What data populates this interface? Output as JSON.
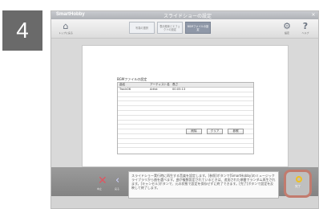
{
  "step_number": "4",
  "window": {
    "app_name": "SmartHobby",
    "title": "スライドショーの設定",
    "close_glyph": "×"
  },
  "toolbar": {
    "home_label": "トップに戻る",
    "settings_label": "設定",
    "help_label": "ヘルプ",
    "tabs": [
      {
        "label": "写真の選択"
      },
      {
        "label": "表示順序とエフェクトの設定"
      },
      {
        "label": "BGMファイルの設定"
      }
    ]
  },
  "panel": {
    "section_title": "BGMファイルの設定",
    "columns": [
      "曲名",
      "アーティスト名",
      "長さ"
    ],
    "rows": [
      [
        "Track06",
        "Artist",
        "00:05:13"
      ]
    ],
    "buttons": {
      "delete": "削除",
      "clear": "クリア",
      "reference": "参照"
    }
  },
  "footer": {
    "cancel_label": "中止",
    "back_label": "戻る",
    "ok_label": "完了",
    "message": "スライドショー実行時に再生する音楽を設定します。[参照]ボタンで[SmartHobby]のミュージックライブラリから曲を選べます。曲が複数設定されているときは、追加された順番でランダム再生されます。[キャンセル]ボタンで、元の状態で設定を保存せずに終了できます。[完了]ボタンで設定を反映して終了します。"
  },
  "icons": {
    "home": "home-icon",
    "settings": "gear-icon",
    "help": "question-icon",
    "cancel": "x-icon",
    "back": "back-arrow-icon",
    "ok": "ok-circle-icon"
  },
  "colors": {
    "highlight": "#c27b6e",
    "cancel": "#e05560",
    "ok": "#f0c020"
  }
}
